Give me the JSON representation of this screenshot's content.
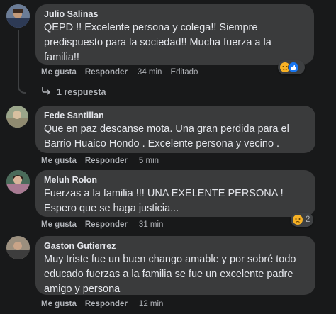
{
  "comments": [
    {
      "author": "Julio Salinas",
      "text": "QEPD !! Excelente persona y colega!! Siempre predispuesto para la sociedad!! Mucha fuerza a la familia!!",
      "like_label": "Me gusta",
      "reply_label": "Responder",
      "time": "34 min",
      "edited": "Editado",
      "reaction_count": "",
      "reactions": [
        "sad",
        "like"
      ],
      "replies_label": "1 respuesta"
    },
    {
      "author": "Fede Santillan",
      "text": "Que en paz descanse mota. Una gran perdida para el Barrio Huaico Hondo . Excelente persona y vecino .",
      "like_label": "Me gusta",
      "reply_label": "Responder",
      "time": "5 min"
    },
    {
      "author": "Meluh Rolon",
      "text": "Fuerzas a la familia !!! UNA EXELENTE PERSONA ! Espero que se haga justicia...",
      "like_label": "Me gusta",
      "reply_label": "Responder",
      "time": "31 min",
      "reaction_count": "2",
      "reactions": [
        "sad"
      ]
    },
    {
      "author": "Gaston Gutierrez",
      "text": "Muy triste fue un buen chango amable y por sobré todo educado fuerzas a la familia se fue un excelente padre amigo y persona",
      "like_label": "Me gusta",
      "reply_label": "Responder",
      "time": "12 min"
    }
  ],
  "colors": {
    "background": "#18191a",
    "bubble": "#3a3b3c",
    "secondary_text": "#b0b3b8",
    "sad_reaction": "#f7b125",
    "like_reaction": "#1877f2"
  }
}
